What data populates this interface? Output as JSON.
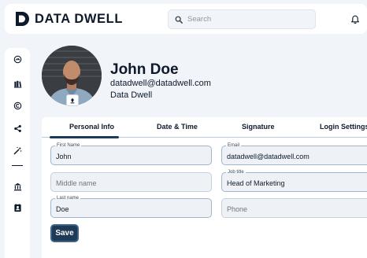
{
  "app": {
    "brand": "Data Dwell"
  },
  "header": {
    "search_placeholder": "Search",
    "icons": [
      "search-icon",
      "bell-icon"
    ]
  },
  "sidebar": {
    "items": [
      {
        "icon": "dashboard-icon"
      },
      {
        "icon": "books-icon"
      },
      {
        "icon": "copyright-icon"
      },
      {
        "icon": "share-icon"
      },
      {
        "icon": "magic-wand-icon"
      },
      {
        "icon": "bank-icon"
      },
      {
        "icon": "contact-card-icon"
      }
    ]
  },
  "profile": {
    "name": "John Doe",
    "email": "datadwell@datadwell.com",
    "company": "Data Dwell"
  },
  "tabs": [
    {
      "label": "Personal Info",
      "active": true
    },
    {
      "label": "Date & Time",
      "active": false
    },
    {
      "label": "Signature",
      "active": false
    },
    {
      "label": "Login Settings",
      "active": false
    }
  ],
  "form": {
    "first_name": {
      "label": "First Name",
      "value": "John"
    },
    "middle_name": {
      "placeholder": "Middle name"
    },
    "last_name": {
      "label": "Last name",
      "value": "Doe"
    },
    "email": {
      "label": "Email",
      "value": "datadwell@datadwell.com"
    },
    "job_title": {
      "label": "Job title",
      "value": "Head of Marketing"
    },
    "phone": {
      "placeholder": "Phone"
    },
    "save_label": "Save"
  },
  "colors": {
    "primary": "#1e3a56",
    "text": "#0e1a2b",
    "background": "#f1f4f8",
    "field_border": "#9fb6cc"
  }
}
